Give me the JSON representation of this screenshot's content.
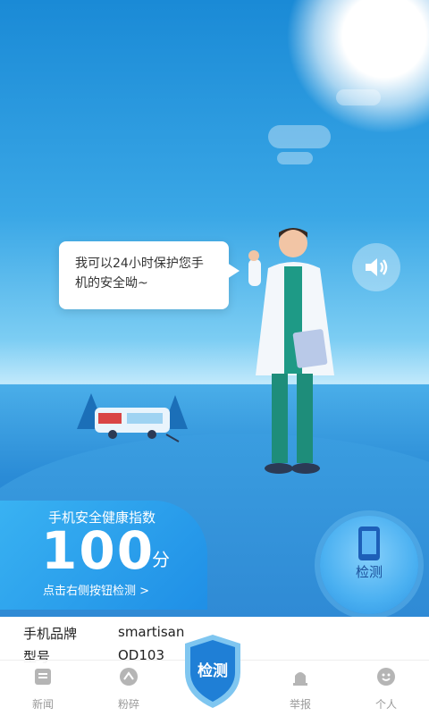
{
  "bubble": {
    "line1": "我可以24小时保护您手",
    "line2": "机的安全呦~"
  },
  "score": {
    "title": "手机安全健康指数",
    "value": "100",
    "unit": "分",
    "hint": "点击右侧按钮检测 >"
  },
  "detect_button": {
    "label": "检测"
  },
  "info": [
    {
      "label": "手机品牌",
      "value": "smartisan"
    },
    {
      "label": "型号",
      "value": "OD103"
    }
  ],
  "tabbar": {
    "items": [
      {
        "label": "新闻",
        "icon": "news-icon"
      },
      {
        "label": "粉碎",
        "icon": "shred-icon"
      },
      {
        "label": "检测",
        "icon": "shield-icon"
      },
      {
        "label": "举报",
        "icon": "report-icon"
      },
      {
        "label": "个人",
        "icon": "profile-icon"
      }
    ]
  },
  "colors": {
    "primary": "#1f8fe6",
    "accent": "#39b2f2",
    "tab_inactive": "#9a9a9a"
  }
}
